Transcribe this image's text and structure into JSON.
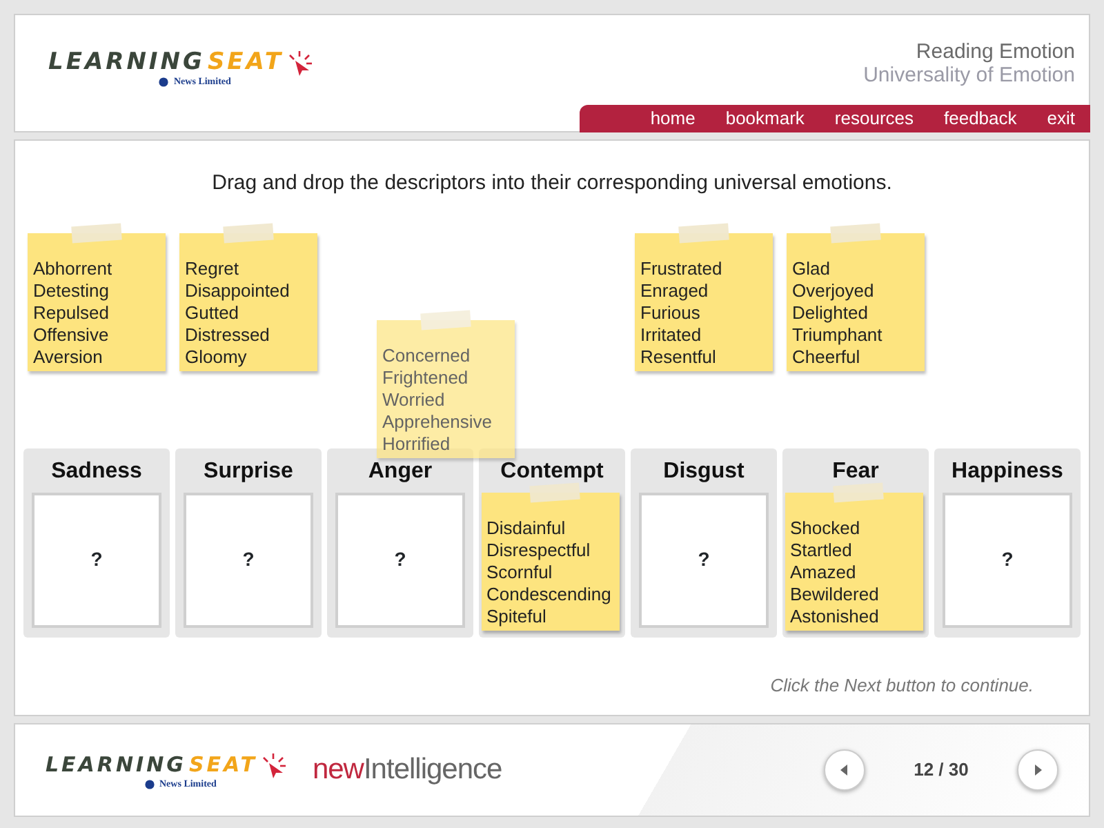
{
  "header": {
    "logo": {
      "word_1": "LEARNING",
      "word_2": "SEAT",
      "tagline": "News Limited"
    },
    "course_title": "Reading Emotion",
    "topic_title": "Universality of Emotion",
    "nav": [
      "home",
      "bookmark",
      "resources",
      "feedback",
      "exit"
    ]
  },
  "instruction": "Drag and drop the descriptors into their corresponding universal emotions.",
  "pool": [
    {
      "kind": "note",
      "words": [
        "Abhorrent",
        "Detesting",
        "Repulsed",
        "Offensive",
        "Aversion"
      ]
    },
    {
      "kind": "note",
      "words": [
        "Regret",
        "Disappointed",
        "Gutted",
        "Distressed",
        "Gloomy"
      ]
    },
    {
      "kind": "empty"
    },
    {
      "kind": "empty"
    },
    {
      "kind": "note",
      "words": [
        "Frustrated",
        "Enraged",
        "Furious",
        "Irritated",
        "Resentful"
      ]
    },
    {
      "kind": "note",
      "words": [
        "Glad",
        "Overjoyed",
        "Delighted",
        "Triumphant",
        "Cheerful"
      ]
    },
    {
      "kind": "empty"
    }
  ],
  "dragged_note": {
    "dragging": true,
    "words": [
      "Concerned",
      "Frightened",
      "Worried",
      "Apprehensive",
      "Horrified"
    ]
  },
  "zones": [
    {
      "label": "Sadness",
      "kind": "empty",
      "answer": "?"
    },
    {
      "label": "Surprise",
      "kind": "empty",
      "answer": "?"
    },
    {
      "label": "Anger",
      "kind": "empty",
      "answer": "?"
    },
    {
      "label": "Contempt",
      "kind": "filled",
      "words": [
        "Disdainful",
        "Disrespectful",
        "Scornful",
        "Condescending",
        "Spiteful"
      ]
    },
    {
      "label": "Disgust",
      "kind": "empty",
      "answer": "?"
    },
    {
      "label": "Fear",
      "kind": "filled",
      "words": [
        "Shocked",
        "Startled",
        "Amazed",
        "Bewildered",
        "Astonished"
      ]
    },
    {
      "label": "Happiness",
      "kind": "empty",
      "answer": "?"
    }
  ],
  "hint": "Click the Next button to continue.",
  "footer": {
    "logo": {
      "word_1": "LEARNING",
      "word_2": "SEAT",
      "tagline": "News Limited"
    },
    "partner_1": "new",
    "partner_2": "Intelligence",
    "page": "12 / 30"
  }
}
